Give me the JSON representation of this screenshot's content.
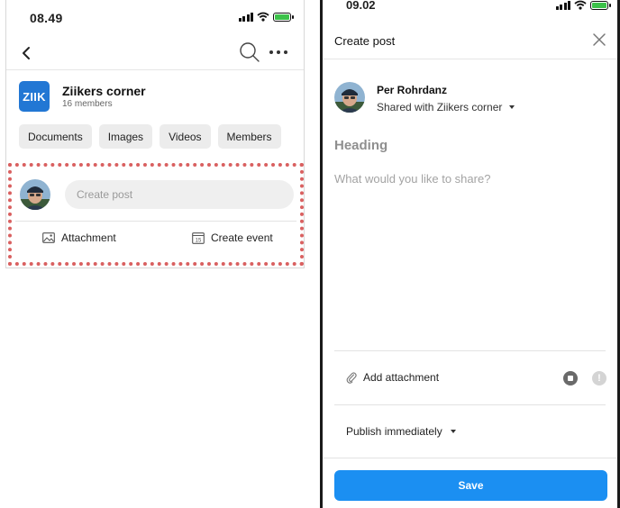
{
  "left_screen": {
    "status_time": "08.49",
    "group": {
      "logo_text": "ZIIK",
      "name": "Ziikers corner",
      "members": "16 members"
    },
    "chips": [
      "Documents",
      "Images",
      "Videos",
      "Members"
    ],
    "compose": {
      "placeholder": "Create post",
      "attachment_label": "Attachment",
      "event_label": "Create event",
      "calendar_day": "15"
    },
    "icons": [
      "back-chevron-icon",
      "search-icon",
      "more-icon",
      "image-icon",
      "calendar-icon"
    ]
  },
  "right_screen": {
    "status_time": "09.02",
    "title": "Create post",
    "author": {
      "name": "Per Rohrdanz",
      "shared_with": "Shared with Ziikers corner"
    },
    "heading_placeholder": "Heading",
    "body_placeholder": "What would you like to share?",
    "add_attachment": "Add attachment",
    "info_glyph": "!",
    "publish_label": "Publish immediately",
    "save_label": "Save",
    "icons": [
      "close-icon",
      "paperclip-icon",
      "stop-icon",
      "info-icon",
      "caret-down-icon"
    ]
  },
  "colors": {
    "brand_blue": "#2277d4",
    "save_button": "#1b8ff2",
    "highlight_dots": "#d96060",
    "battery_green": "#3cc24a"
  }
}
